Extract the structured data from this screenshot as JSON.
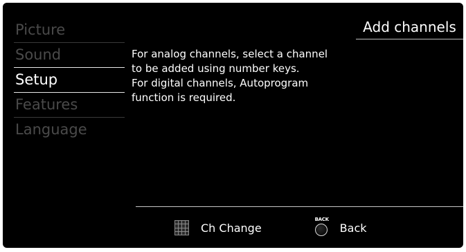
{
  "menu": {
    "items": [
      {
        "label": "Picture"
      },
      {
        "label": "Sound"
      },
      {
        "label": "Setup"
      },
      {
        "label": "Features"
      },
      {
        "label": "Language"
      }
    ],
    "selected": "Setup"
  },
  "panel": {
    "title": "Add channels",
    "message_lines": [
      "For analog channels, select a channel",
      "to be added using number keys.",
      "For digital channels, Autoprogram",
      "function is required."
    ]
  },
  "footer": {
    "ch_change_label": "Ch Change",
    "back_icon_text": "BACK",
    "back_label": "Back"
  },
  "colors": {
    "background": "#000000",
    "text_active": "#ffffff",
    "text_inactive": "#4a4a4a"
  }
}
